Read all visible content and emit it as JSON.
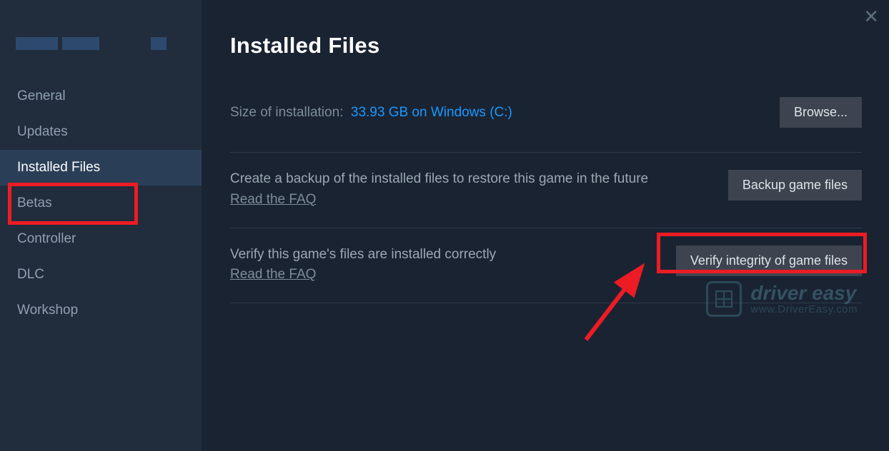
{
  "sidebar": {
    "items": [
      {
        "label": "General"
      },
      {
        "label": "Updates"
      },
      {
        "label": "Installed Files"
      },
      {
        "label": "Betas"
      },
      {
        "label": "Controller"
      },
      {
        "label": "DLC"
      },
      {
        "label": "Workshop"
      }
    ]
  },
  "main": {
    "title": "Installed Files",
    "size_label": "Size of installation:",
    "size_value": "33.93 GB on Windows (C:)",
    "browse_label": "Browse...",
    "backup_text": "Create a backup of the installed files to restore this game in the future",
    "faq_link": "Read the FAQ",
    "backup_button": "Backup game files",
    "verify_text": "Verify this game's files are installed correctly",
    "verify_button": "Verify integrity of game files"
  },
  "close_icon": "✕",
  "watermark": {
    "title": "driver easy",
    "url": "www.DriverEasy.com"
  }
}
